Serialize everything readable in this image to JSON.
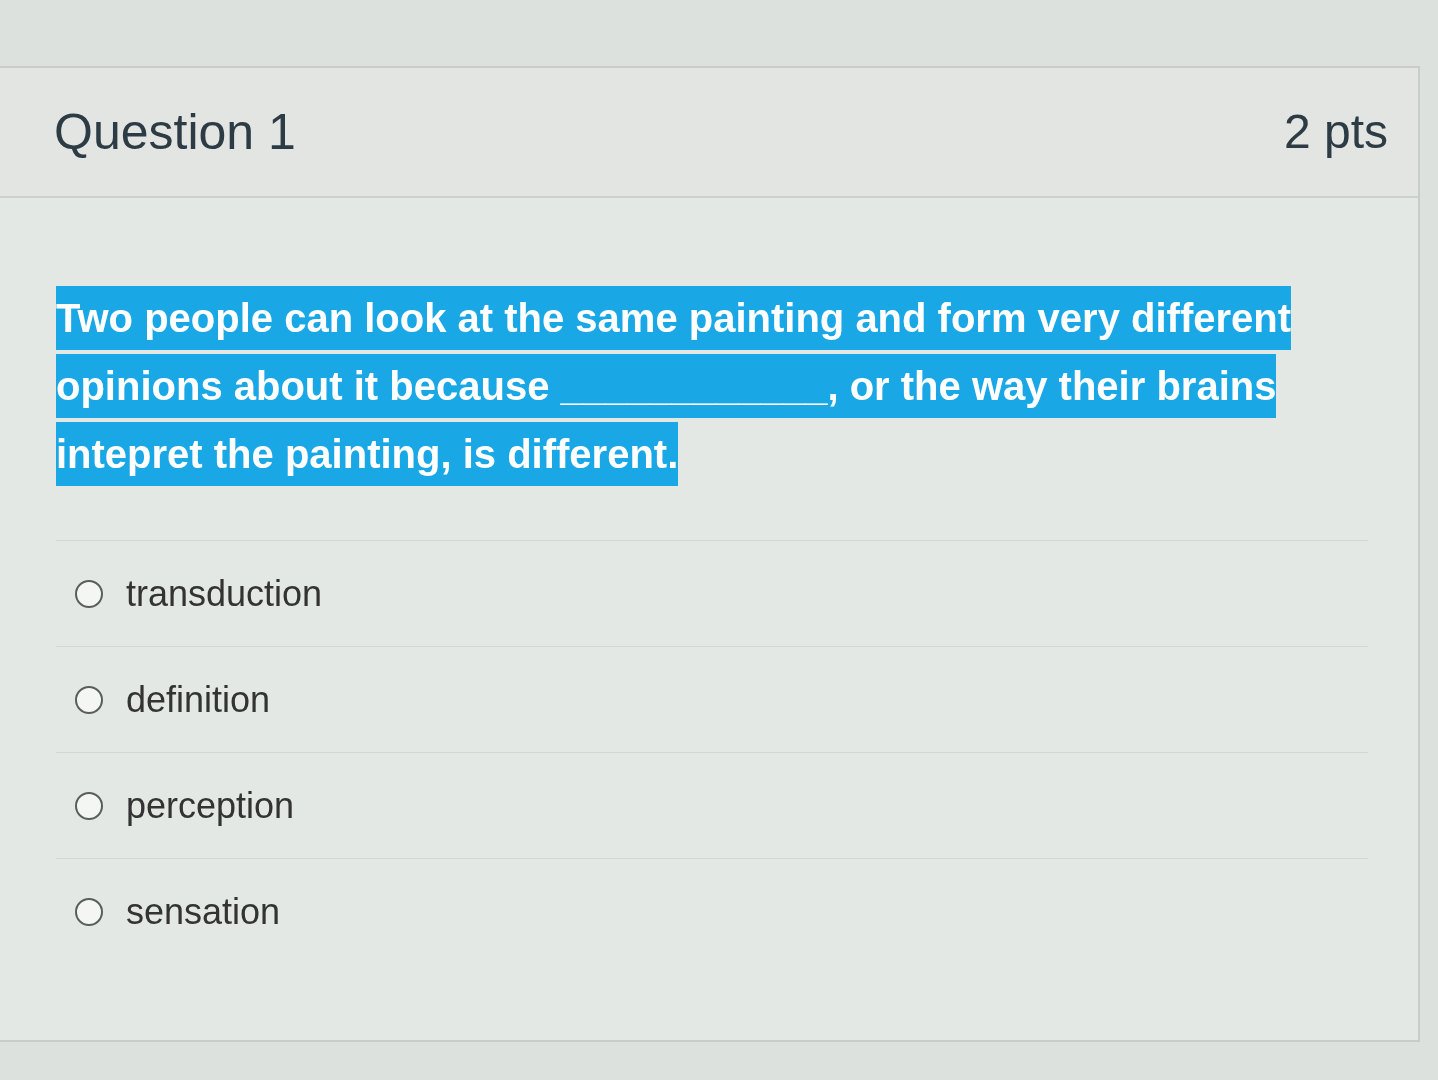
{
  "header": {
    "title": "Question 1",
    "points": "2 pts"
  },
  "question": {
    "text": "Two people can look at the same painting and form very different opinions about it because ____________, or the way their brains intepret the painting, is different.",
    "highlighted": true
  },
  "options": [
    {
      "label": "transduction",
      "selected": false
    },
    {
      "label": "definition",
      "selected": false
    },
    {
      "label": "perception",
      "selected": false
    },
    {
      "label": "sensation",
      "selected": false
    }
  ]
}
